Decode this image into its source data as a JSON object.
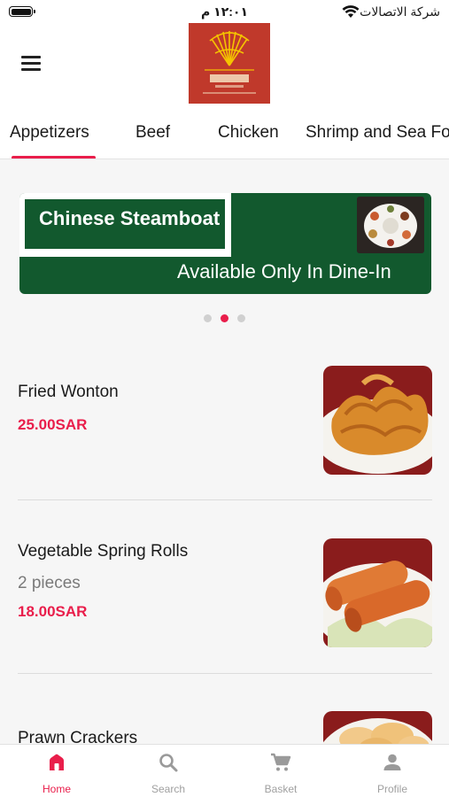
{
  "status_bar": {
    "carrier": "شركة الاتصالات",
    "time": "١٢:٠١ م"
  },
  "header": {
    "logo_icon": "restaurant-logo-fan"
  },
  "tabs": [
    {
      "label": "Appetizers",
      "active": true
    },
    {
      "label": "Beef"
    },
    {
      "label": "Chicken"
    },
    {
      "label": "Shrimp and Sea Fo"
    }
  ],
  "banner": {
    "title": "Chinese Steamboat",
    "subtitle": "Available Only In Dine-In"
  },
  "carousel": {
    "count": 3,
    "active_index": 1
  },
  "items": [
    {
      "name": "Fried Wonton",
      "desc": "",
      "price": "25.00SAR"
    },
    {
      "name": "Vegetable Spring Rolls",
      "desc": "2 pieces",
      "price": "18.00SAR"
    },
    {
      "name": "Prawn Crackers",
      "desc": "",
      "price": ""
    }
  ],
  "bottom_nav": [
    {
      "label": "Home",
      "icon": "home-icon",
      "active": true
    },
    {
      "label": "Search",
      "icon": "search-icon"
    },
    {
      "label": "Basket",
      "icon": "cart-icon"
    },
    {
      "label": "Profile",
      "icon": "person-icon"
    }
  ],
  "colors": {
    "accent": "#e91e4b",
    "banner_green": "#12592e",
    "logo_red": "#c0392b"
  }
}
